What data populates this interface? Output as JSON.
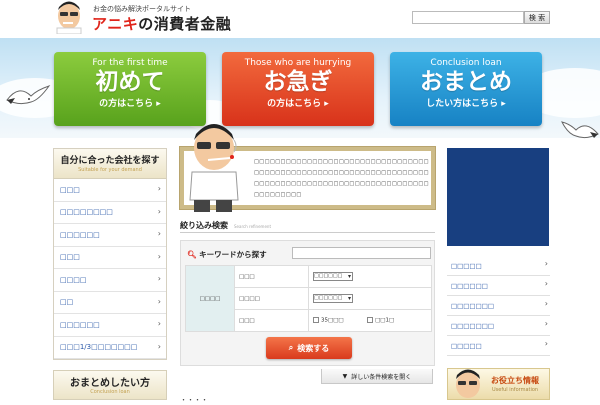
{
  "header": {
    "tagline": "お金の悩み解決ポータルサイト",
    "logo_accent": "アニキ",
    "logo_rest": "の消費者金融",
    "search_placeholder": "",
    "search_button": "検 索"
  },
  "hero_buttons": [
    {
      "en": "For the first time",
      "jp": "初めて",
      "sub": "の方はこちら ▸"
    },
    {
      "en": "Those who are hurrying",
      "jp": "お急ぎ",
      "sub": "の方はこちら ▸"
    },
    {
      "en": "Conclusion loan",
      "jp": "おまとめ",
      "sub": "したい方はこちら ▸"
    }
  ],
  "sidebar": {
    "title": "自分に合った会社を探す",
    "subtitle": "Suitable for your demand",
    "items": [
      {
        "label": "□□□"
      },
      {
        "label": "□□□□□□□□"
      },
      {
        "label": "□□□□□□"
      },
      {
        "label": "□□□"
      },
      {
        "label": "□□□□"
      },
      {
        "label": "□□"
      },
      {
        "label": "□□□□□□"
      },
      {
        "label": "□□□1/3□□□□□□□"
      }
    ]
  },
  "sidebar2": {
    "title": "おまとめしたい方",
    "subtitle": "Conclusion loan"
  },
  "intro": {
    "text": "□□□□□□□□□□□□□□□□□□□□□□□□□□□□□□□□□□□□□□□□□□□□□□□□□□□□□□□□□□□□□□□□□□□□□□□□□□□□□□□□□□□□□□□□□□□□□□□□□□□□□□□□□□□□"
  },
  "filter": {
    "heading": "絞り込み検索",
    "heading_sub": "Search refinement",
    "keyword_label": "キーワードから探す",
    "category": "□□□□",
    "rows": [
      {
        "label": "□□□",
        "select": "□□□□□□"
      },
      {
        "label": "□□□□",
        "select": "□□□□□□"
      },
      {
        "label": "□□□",
        "check1": "35□□□",
        "check2": "□□1□"
      }
    ],
    "submit": "検索する",
    "advanced": "詳しい条件検索を開く"
  },
  "partial_heading": "・・・・",
  "right_list": [
    {
      "label": "□□□□□"
    },
    {
      "label": "□□□□□□"
    },
    {
      "label": "□□□□□□□"
    },
    {
      "label": "□□□□□□□"
    },
    {
      "label": "□□□□□"
    }
  ],
  "useful": {
    "title": "お役立ち情報",
    "subtitle": "Useful information"
  },
  "colors": {
    "green": "#6db52a",
    "red": "#e44a26",
    "blue": "#2796d4",
    "ad_blue": "#183f80",
    "link": "#2a58a8"
  }
}
